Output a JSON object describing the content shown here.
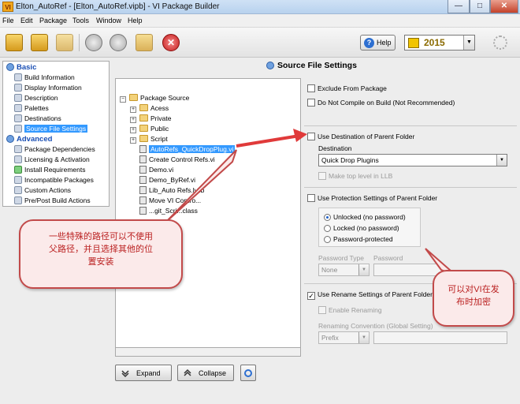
{
  "window": {
    "title": "Elton_AutoRef - [Elton_AutoRef.vipb] - VI Package Builder",
    "app_icon_text": "VI",
    "minimize": "—",
    "maximize": "□",
    "close": "✕"
  },
  "menu": [
    "File",
    "Edit",
    "Package",
    "Tools",
    "Window",
    "Help"
  ],
  "toolbar": {
    "stop_glyph": "✕",
    "help_label": "Help",
    "help_glyph": "?",
    "version": "2015",
    "dropdown_glyph": "▼"
  },
  "nav": {
    "basic": "Basic",
    "basic_items": [
      "Build Information",
      "Display Information",
      "Description",
      "Palettes",
      "Destinations",
      "Source File Settings"
    ],
    "advanced": "Advanced",
    "advanced_items": [
      "Package Dependencies",
      "Licensing & Activation",
      "Install Requirements",
      "Incompatible Packages",
      "Custom Actions",
      "Pre/Post Build Actions"
    ]
  },
  "tree": {
    "root": "Package Source",
    "items": [
      "Acess",
      "Private",
      "Public",
      "Script",
      "AutoRefs_QuickDropPlug.vi",
      "Create Control Refs.vi",
      "Demo.vi",
      "Demo_ByRef.vi",
      "Lib_Auto Refs.lvlib",
      "Move VI Contro...",
      "...git_Scri...class"
    ],
    "expand_glyph": "+",
    "collapse_glyph": "−"
  },
  "buttons": {
    "expand": "Expand",
    "collapse": "Collapse"
  },
  "settings": {
    "title": "Source File Settings",
    "exclude": "Exclude From Package",
    "no_compile": "Do Not Compile on Build (Not Recommended)",
    "use_dest_parent": "Use Destination of Parent Folder",
    "destination_label": "Destination",
    "destination_value": "Quick Drop Plugins",
    "make_top_level": "Make top level in LLB",
    "use_protection_parent": "Use Protection Settings of Parent Folder",
    "radio_unlocked": "Unlocked (no password)",
    "radio_locked": "Locked (no password)",
    "radio_password": "Password-protected",
    "password_type_label": "Password Type",
    "password_label": "Password",
    "password_type_value": "None",
    "use_rename_parent": "Use Rename Settings of Parent Folder",
    "rename_check": "✓",
    "enable_renaming": "Enable Renaming",
    "renaming_convention_label": "Renaming Convention (Global Setting)",
    "renaming_value": "Prefix"
  },
  "callouts": {
    "left_line1": "一些特殊的路径可以不使用",
    "left_line2": "父路径，并且选择其他的位",
    "left_line3": "置安装",
    "right_line1": "可以对VI在发",
    "right_line2": "布时加密"
  },
  "colors": {
    "selection": "#3399ff",
    "callout_border": "#c24a4a",
    "callout_text": "#bb2222",
    "arrow": "#e03a3a"
  }
}
